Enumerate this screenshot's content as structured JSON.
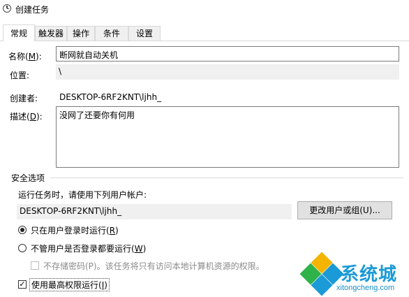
{
  "window": {
    "title": "创建任务"
  },
  "tabs": [
    {
      "label": "常规",
      "active": true
    },
    {
      "label": "触发器",
      "active": false
    },
    {
      "label": "操作",
      "active": false
    },
    {
      "label": "条件",
      "active": false
    },
    {
      "label": "设置",
      "active": false
    }
  ],
  "general": {
    "name_label": "名称(",
    "name_accel": "M",
    "name_label_end": "):",
    "name_value": "断网就自动关机",
    "location_label": "位置:",
    "location_value": "\\",
    "author_label": "创建者:",
    "author_value": "DESKTOP-6RF2KNT\\ljhh_",
    "desc_label": "描述(",
    "desc_accel": "D",
    "desc_label_end": "):",
    "desc_value": "没网了还要你有何用"
  },
  "security": {
    "group_label": "安全选项",
    "run_as_label": "运行任务时，请使用下列用户帐户:",
    "run_as_value": "DESKTOP-6RF2KNT\\ljhh_",
    "change_user_button": "更改用户或组(U)...",
    "radio_logged_on": "只在用户登录时运行(",
    "radio_logged_on_accel": "R",
    "radio_logged_on_end": ")",
    "radio_whether": "不管用户是否登录都要运行(",
    "radio_whether_accel": "W",
    "radio_whether_end": ")",
    "no_store_password": "不存储密码(P)。该任务将只有访问本地计算机资源的权限。",
    "highest_priv": "使用最高权限运行(",
    "highest_priv_accel": "I",
    "highest_priv_end": ")"
  },
  "watermark": {
    "brand": "系统城",
    "url": "xitongcheng.com"
  }
}
